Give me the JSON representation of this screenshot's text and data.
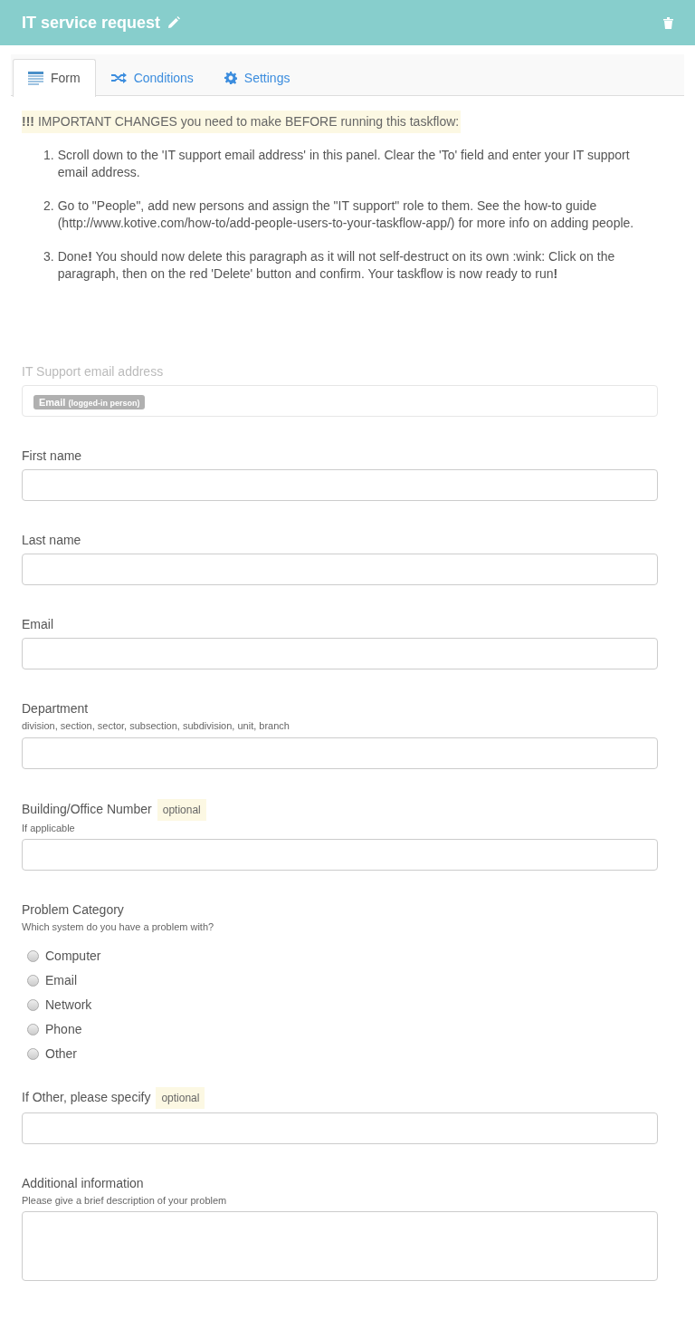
{
  "header": {
    "title": "IT service request"
  },
  "tabs": [
    {
      "label": "Form",
      "selected": true
    },
    {
      "label": "Conditions",
      "selected": false
    },
    {
      "label": "Settings",
      "selected": false
    }
  ],
  "notice": {
    "heading": "**!!!** IMPORTANT CHANGES you need to make BEFORE running this taskflow:",
    "markers": [
      "1.",
      "2.",
      "3."
    ],
    "steps": [
      "Scroll down to the 'IT support email address' in this panel. Clear the 'To' field and enter your IT support email address.",
      "Go to \"People\", add new persons and assign the \"IT support\" role to them. See the how-to guide (http://www.kotive.com/how-to/add-people-users-to-your-taskflow-app/) for more info on adding people.",
      "Done**!** You should now delete this paragraph as it will not self-destruct on its own :wink: Click on the paragraph, then on the red 'Delete' button and confirm. Your taskflow is now ready to run**!**"
    ]
  },
  "fields": [
    {
      "kind": "token",
      "label": "IT Support email address",
      "disabled": true,
      "token": {
        "name": "Email",
        "detail": "(logged-in person)"
      }
    },
    {
      "kind": "text",
      "label": "First name",
      "disabled": false
    },
    {
      "kind": "text",
      "label": "Last name",
      "disabled": false
    },
    {
      "kind": "text",
      "label": "Email",
      "disabled": false
    },
    {
      "kind": "text",
      "label": "Department",
      "disabled": false,
      "help": "division, section, sector, subsection, subdivision, unit, branch"
    },
    {
      "kind": "text",
      "label": "Building/Office Number",
      "disabled": false,
      "optional": "optional",
      "help": "If applicable"
    },
    {
      "kind": "radio",
      "label": "Problem Category",
      "disabled": false,
      "help": "Which system do you have a problem with?",
      "options": [
        {
          "label": "Computer",
          "selected": false
        },
        {
          "label": "Email",
          "selected": false
        },
        {
          "label": "Network",
          "selected": false
        },
        {
          "label": "Phone",
          "selected": false
        },
        {
          "label": "Other",
          "selected": false
        }
      ]
    },
    {
      "kind": "text",
      "label": "If Other, please specify",
      "disabled": false,
      "optional": "optional"
    },
    {
      "kind": "textarea",
      "label": "Additional information",
      "disabled": false,
      "help": "Please give a brief description of your problem"
    }
  ]
}
